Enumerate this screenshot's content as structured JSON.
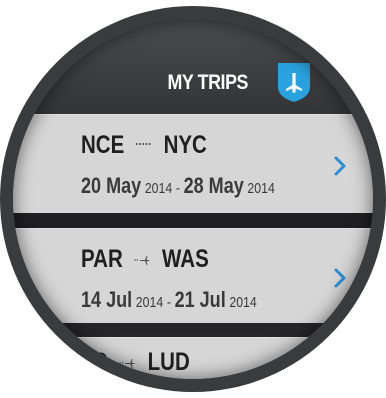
{
  "header": {
    "title": "MY TRIPS",
    "badge_icon": "airplane-icon",
    "badge_color": "#29a3e0"
  },
  "trips": [
    {
      "origin": "NCE",
      "destination": "NYC",
      "route_icon": "dotted-line-icon",
      "start_day_month": "20 May",
      "start_year": "2014",
      "separator": "-",
      "end_day_month": "28 May",
      "end_year": "2014",
      "chevron_icon": "chevron-right-icon"
    },
    {
      "origin": "PAR",
      "destination": "WAS",
      "route_icon": "small-airplane-icon",
      "start_day_month": "14 Jul",
      "start_year": "2014",
      "separator": "-",
      "end_day_month": "21 Jul",
      "end_year": "2014",
      "chevron_icon": "chevron-right-icon"
    },
    {
      "origin": "LD",
      "destination": "LUD",
      "route_icon": "small-airplane-icon"
    }
  ],
  "colors": {
    "card_background": "#d6d6d6",
    "chevron": "#2a8fd4",
    "text": "#1f1f1f"
  }
}
